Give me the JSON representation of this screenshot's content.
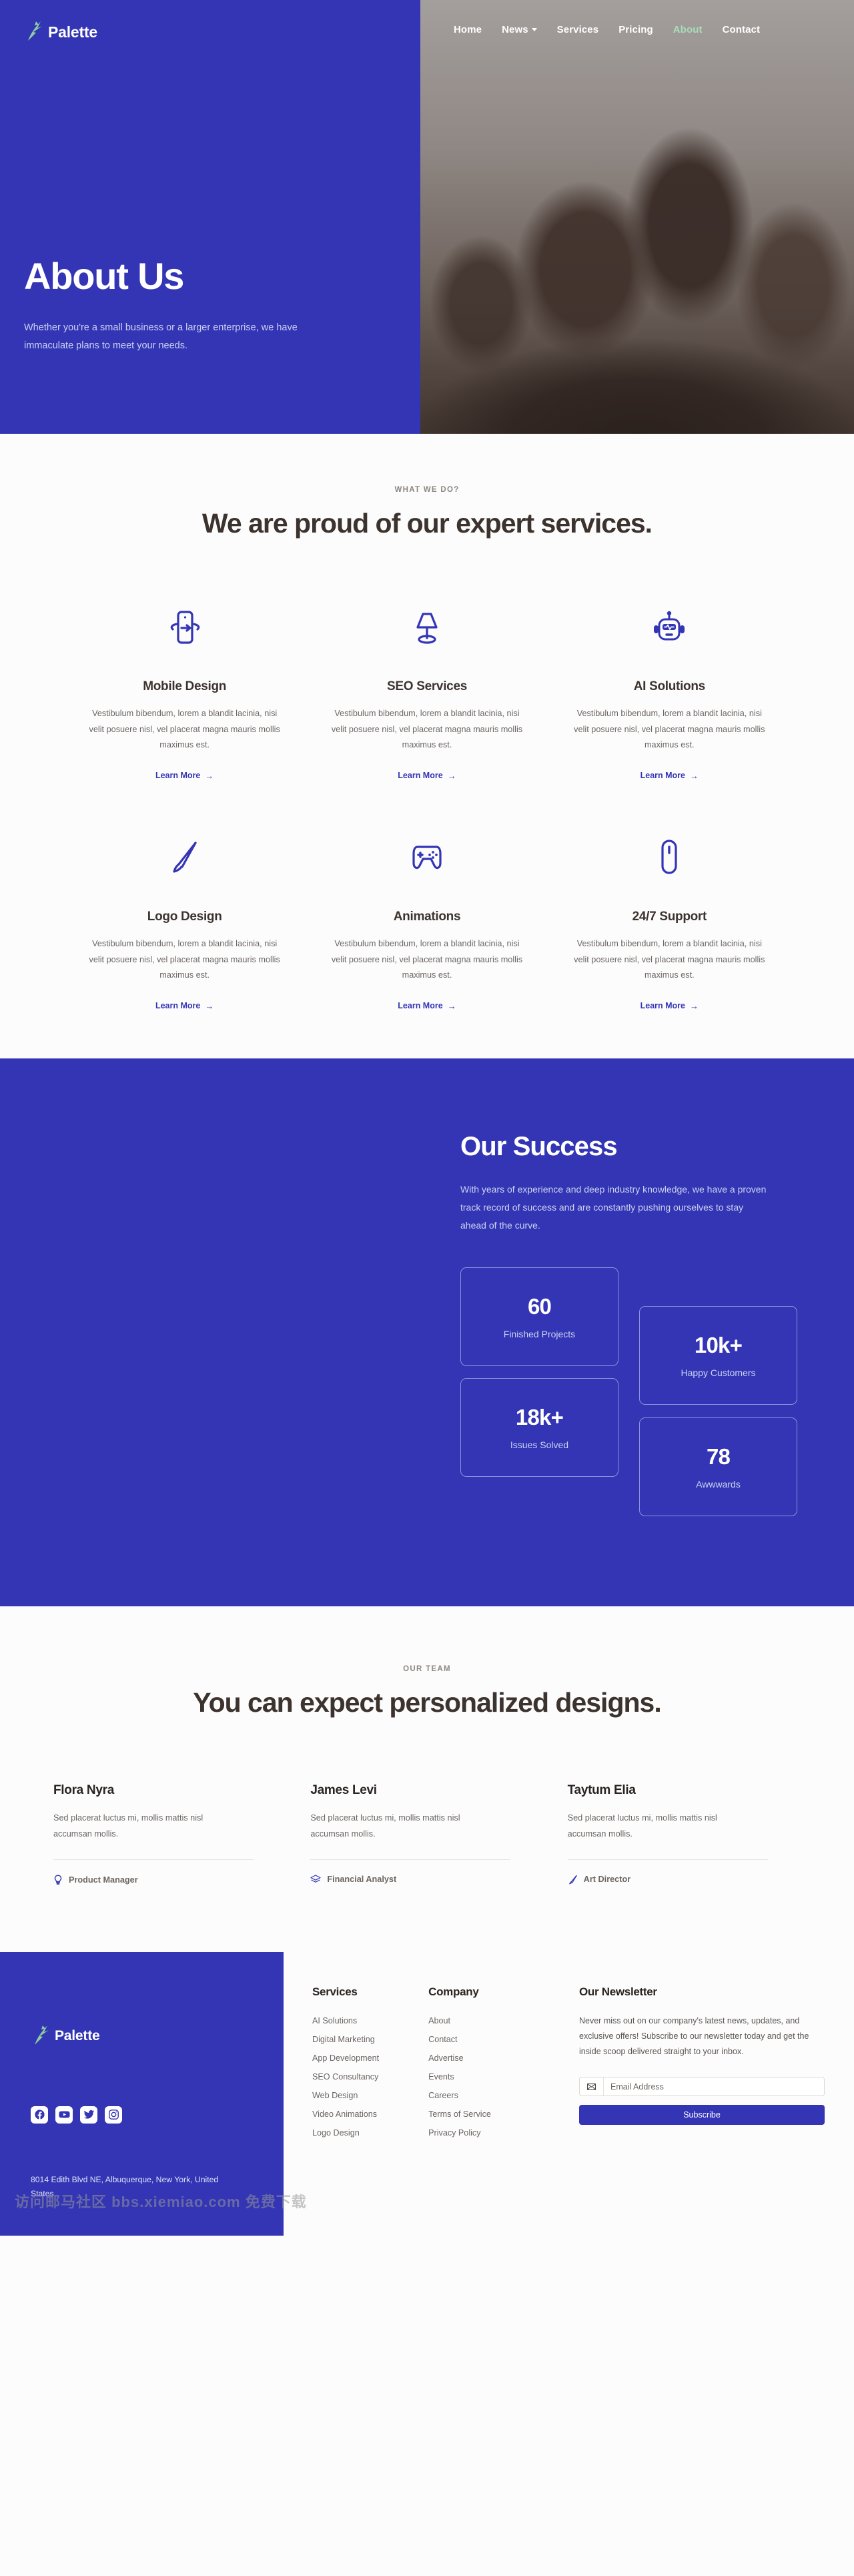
{
  "brand": {
    "name": "Palette",
    "logo_icon": "star-swoosh-logo"
  },
  "nav": {
    "items": [
      {
        "label": "Home",
        "active": false,
        "dropdown": false
      },
      {
        "label": "News",
        "active": false,
        "dropdown": true
      },
      {
        "label": "Services",
        "active": false,
        "dropdown": false
      },
      {
        "label": "Pricing",
        "active": false,
        "dropdown": false
      },
      {
        "label": "About",
        "active": true,
        "dropdown": false
      },
      {
        "label": "Contact",
        "active": false,
        "dropdown": false
      }
    ]
  },
  "hero": {
    "title": "About Us",
    "subtitle": "Whether you're a small business or a larger enterprise, we have immaculate plans to meet your needs."
  },
  "services_section": {
    "eyebrow": "WHAT WE DO?",
    "title": "We are proud of our expert services.",
    "learn_more": "Learn More",
    "arrow": "→",
    "items": [
      {
        "icon": "mobile-rotate-icon",
        "name": "Mobile Design",
        "desc": "Vestibulum bibendum, lorem a blandit lacinia, nisi velit posuere nisl, vel placerat magna mauris mollis maximus est."
      },
      {
        "icon": "lamp-icon",
        "name": "SEO Services",
        "desc": "Vestibulum bibendum, lorem a blandit lacinia, nisi velit posuere nisl, vel placerat magna mauris mollis maximus est."
      },
      {
        "icon": "robot-icon",
        "name": "AI Solutions",
        "desc": "Vestibulum bibendum, lorem a blandit lacinia, nisi velit posuere nisl, vel placerat magna mauris mollis maximus est."
      },
      {
        "icon": "paintbrush-icon",
        "name": "Logo Design",
        "desc": "Vestibulum bibendum, lorem a blandit lacinia, nisi velit posuere nisl, vel placerat magna mauris mollis maximus est."
      },
      {
        "icon": "gamepad-icon",
        "name": "Animations",
        "desc": "Vestibulum bibendum, lorem a blandit lacinia, nisi velit posuere nisl, vel placerat magna mauris mollis maximus est."
      },
      {
        "icon": "mouse-icon",
        "name": "24/7 Support",
        "desc": "Vestibulum bibendum, lorem a blandit lacinia, nisi velit posuere nisl, vel placerat magna mauris mollis maximus est."
      }
    ]
  },
  "success": {
    "title": "Our Success",
    "desc": "With years of experience and deep industry knowledge, we have a proven track record of success and are constantly pushing ourselves to stay ahead of the curve.",
    "stats": [
      {
        "value": "60",
        "label": "Finished Projects"
      },
      {
        "value": "18k+",
        "label": "Issues Solved"
      },
      {
        "value": "10k+",
        "label": "Happy Customers"
      },
      {
        "value": "78",
        "label": "Awwwards"
      }
    ]
  },
  "team_section": {
    "eyebrow": "OUR TEAM",
    "title": "You can expect personalized designs.",
    "members": [
      {
        "name": "Flora Nyra",
        "desc": "Sed placerat luctus mi, mollis mattis nisl accumsan mollis.",
        "role": "Product Manager",
        "role_icon": "lightbulb-icon"
      },
      {
        "name": "James Levi",
        "desc": "Sed placerat luctus mi, mollis mattis nisl accumsan mollis.",
        "role": "Financial Analyst",
        "role_icon": "layers-icon"
      },
      {
        "name": "Taytum Elia",
        "desc": "Sed placerat luctus mi, mollis mattis nisl accumsan mollis.",
        "role": "Art Director",
        "role_icon": "paintbrush-icon"
      }
    ]
  },
  "footer": {
    "address": "8014 Edith Blvd NE, Albuquerque, New York, United States",
    "socials": [
      {
        "icon": "facebook-icon"
      },
      {
        "icon": "youtube-icon"
      },
      {
        "icon": "twitter-icon"
      },
      {
        "icon": "instagram-icon"
      }
    ],
    "columns": [
      {
        "title": "Services",
        "links": [
          "AI Solutions",
          "Digital Marketing",
          "App Development",
          "SEO Consultancy",
          "Web Design",
          "Video Animations",
          "Logo Design"
        ]
      },
      {
        "title": "Company",
        "links": [
          "About",
          "Contact",
          "Advertise",
          "Events",
          "Careers",
          "Terms of Service",
          "Privacy Policy"
        ]
      }
    ],
    "newsletter": {
      "title": "Our Newsletter",
      "desc": "Never miss out on our company's latest news, updates, and exclusive offers! Subscribe to our newsletter today and get the inside scoop delivered straight to your inbox.",
      "placeholder": "Email Address",
      "value": "",
      "button": "Subscribe",
      "mail_icon": "envelope-icon"
    }
  },
  "watermark": {
    "text": "访问邮马社区 bbs.xiemiao.com 免费下载"
  },
  "colors": {
    "brand_blue": "#3335b5",
    "accent_green": "#a9dcb8",
    "text_dark": "#3d332e",
    "text_muted": "#6c6661"
  }
}
